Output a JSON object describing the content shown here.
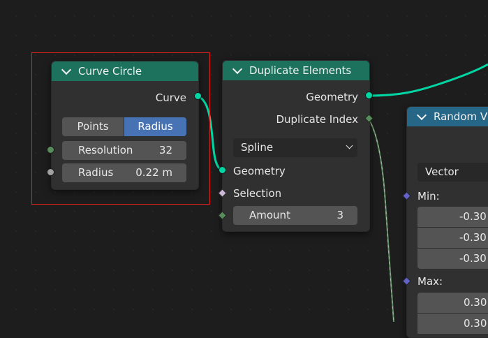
{
  "colors": {
    "background": "#1d1d1d",
    "geometry_link": "#00d6a3",
    "header_geometry": "#1d725e",
    "header_utility": "#266687",
    "selection_frame": "#e0201c",
    "radius_selected": "#4772b3"
  },
  "curve_circle": {
    "title": "Curve Circle",
    "output_label": "Curve",
    "mode_options": [
      "Points",
      "Radius"
    ],
    "mode_selected": "Radius",
    "resolution_label": "Resolution",
    "resolution_value": "32",
    "radius_label": "Radius",
    "radius_value": "0.22 m"
  },
  "duplicate_elements": {
    "title": "Duplicate Elements",
    "output_geometry": "Geometry",
    "output_index": "Duplicate Index",
    "domain": "Spline",
    "input_geometry": "Geometry",
    "input_selection": "Selection",
    "amount_label": "Amount",
    "amount_value": "3"
  },
  "random_value": {
    "title": "Random V",
    "type": "Vector",
    "min_label": "Min:",
    "min_values": [
      "-0.30",
      "-0.30",
      "-0.30"
    ],
    "max_label": "Max:",
    "max_values": [
      "0.30",
      "0.30"
    ]
  }
}
